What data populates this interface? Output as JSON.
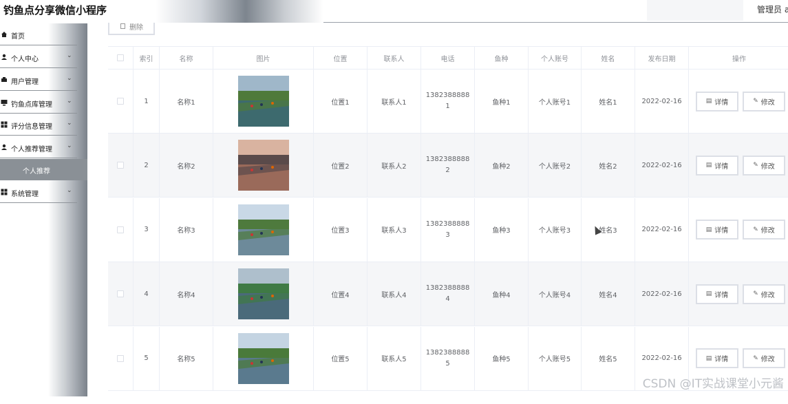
{
  "header": {
    "app_title": "钓鱼点分享微信小程序",
    "admin_label": "管理员 a"
  },
  "sidebar": {
    "items": [
      {
        "label": "首页",
        "icon": "home-icon",
        "has_arrow": false
      },
      {
        "label": "个人中心",
        "icon": "user-icon",
        "has_arrow": true
      },
      {
        "label": "用户管理",
        "icon": "users-icon",
        "has_arrow": true
      },
      {
        "label": "钓鱼点库管理",
        "icon": "monitor-icon",
        "has_arrow": true
      },
      {
        "label": "评分信息管理",
        "icon": "grid-icon",
        "has_arrow": true
      },
      {
        "label": "个人推荐管理",
        "icon": "user-icon",
        "has_arrow": true
      }
    ],
    "active_sub": "个人推荐",
    "system_item": {
      "label": "系统管理",
      "icon": "grid-icon",
      "has_arrow": true
    }
  },
  "toolbar": {
    "delete_label": "删除"
  },
  "table": {
    "columns": [
      "",
      "索引",
      "名称",
      "图片",
      "位置",
      "联系人",
      "电话",
      "鱼种",
      "个人账号",
      "姓名",
      "发布日期",
      "操作"
    ],
    "rows": [
      {
        "index": "1",
        "name": "名称1",
        "location": "位置1",
        "contact": "联系人1",
        "phone": "13823888881",
        "fish": "鱼种1",
        "account": "个人账号1",
        "person": "姓名1",
        "date": "2022-02-16"
      },
      {
        "index": "2",
        "name": "名称2",
        "location": "位置2",
        "contact": "联系人2",
        "phone": "13823888882",
        "fish": "鱼种2",
        "account": "个人账号2",
        "person": "姓名2",
        "date": "2022-02-16"
      },
      {
        "index": "3",
        "name": "名称3",
        "location": "位置3",
        "contact": "联系人3",
        "phone": "13823888883",
        "fish": "鱼种3",
        "account": "个人账号3",
        "person": "姓名3",
        "date": "2022-02-16"
      },
      {
        "index": "4",
        "name": "名称4",
        "location": "位置4",
        "contact": "联系人4",
        "phone": "13823888884",
        "fish": "鱼种4",
        "account": "个人账号4",
        "person": "姓名4",
        "date": "2022-02-16"
      },
      {
        "index": "5",
        "name": "名称5",
        "location": "位置5",
        "contact": "联系人5",
        "phone": "13823888885",
        "fish": "鱼种5",
        "account": "个人账号5",
        "person": "姓名5",
        "date": "2022-02-16"
      }
    ],
    "detail_label": "详情",
    "edit_label": "修改"
  },
  "watermark": "CSDN @IT实战课堂小元酱",
  "colors": {
    "sidebar_active": "#8a9096",
    "row_alt": "#f5f6f8",
    "border": "#ebeef5"
  }
}
